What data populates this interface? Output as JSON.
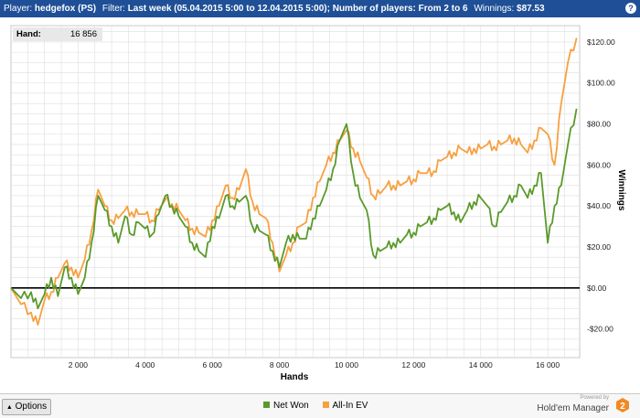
{
  "header": {
    "player_label": "Player:",
    "player_value": "hedgefox (PS)",
    "filter_label": "Filter:",
    "filter_value": "Last week (05.04.2015 5:00 to 12.04.2015 5:00); Number of players: From 2 to 6",
    "winnings_label": "Winnings:",
    "winnings_value": "$87.53",
    "help_icon": "help-icon"
  },
  "hand_box": {
    "label": "Hand:",
    "value": "16 856"
  },
  "bottom_bar": {
    "options_label": "Options",
    "options_icon": "caret-up-icon",
    "powered_by": "Powered by",
    "brand_name": "Hold'em Manager",
    "logo_icon": "hm2-logo-icon",
    "logo_text": "2"
  },
  "colors": {
    "title_bar": "#1f4f96",
    "net_won": "#5a9a2a",
    "all_in_ev": "#f7a040",
    "zero_line": "#000000",
    "grid": "#dedede",
    "logo": "#f08a24"
  },
  "chart_data": {
    "type": "line",
    "xlabel": "Hands",
    "ylabel": "Winnings",
    "xlim": [
      0,
      16950
    ],
    "ylim": [
      -34,
      128
    ],
    "x_ticks": [
      2000,
      4000,
      6000,
      8000,
      10000,
      12000,
      14000,
      16000
    ],
    "x_tick_labels": [
      "2 000",
      "4 000",
      "6 000",
      "8 000",
      "10 000",
      "12 000",
      "14 000",
      "16 000"
    ],
    "y_ticks": [
      -20,
      0,
      20,
      40,
      60,
      80,
      100,
      120
    ],
    "y_tick_labels": [
      "-$20.00",
      "$0.00",
      "$20.00",
      "$40.00",
      "$60.00",
      "$80.00",
      "$100.00",
      "$120.00"
    ],
    "grid": true,
    "legend_position": "bottom-center",
    "series": [
      {
        "name": "Net Won",
        "x": [
          0,
          300,
          600,
          800,
          1000,
          1200,
          1400,
          1600,
          1800,
          2000,
          2200,
          2400,
          2600,
          2800,
          3000,
          3200,
          3400,
          3600,
          3800,
          4000,
          4200,
          4400,
          4600,
          4800,
          5000,
          5200,
          5400,
          5600,
          5800,
          6000,
          6200,
          6400,
          6600,
          6800,
          7000,
          7200,
          7400,
          7600,
          7800,
          8000,
          8200,
          8400,
          8600,
          8800,
          9000,
          9200,
          9400,
          9600,
          9800,
          10000,
          10200,
          10400,
          10600,
          10800,
          11000,
          11200,
          11400,
          11600,
          11800,
          12000,
          12200,
          12400,
          12600,
          12800,
          13000,
          13200,
          13400,
          13600,
          13800,
          14000,
          14200,
          14400,
          14600,
          14800,
          15000,
          15200,
          15400,
          15600,
          15800,
          16000,
          16200,
          16400,
          16600,
          16856
        ],
        "y": [
          0,
          -5,
          -2,
          -10,
          -3,
          5,
          -4,
          10,
          5,
          -3,
          5,
          22,
          45,
          38,
          30,
          22,
          35,
          26,
          32,
          29,
          26,
          36,
          45,
          40,
          35,
          30,
          22,
          18,
          15,
          30,
          34,
          45,
          40,
          42,
          45,
          30,
          28,
          26,
          18,
          10,
          22,
          26,
          24,
          24,
          34,
          40,
          48,
          58,
          72,
          80,
          56,
          44,
          38,
          16,
          18,
          20,
          22,
          22,
          26,
          27,
          30,
          32,
          34,
          38,
          40,
          37,
          32,
          38,
          42,
          44,
          40,
          30,
          37,
          42,
          45,
          50,
          44,
          50,
          56,
          22,
          40,
          50,
          70,
          87.5
        ]
      },
      {
        "name": "All-In EV",
        "x": [
          0,
          300,
          600,
          800,
          1000,
          1200,
          1400,
          1600,
          1800,
          2000,
          2200,
          2400,
          2600,
          2800,
          3000,
          3200,
          3400,
          3600,
          3800,
          4000,
          4200,
          4400,
          4600,
          4800,
          5000,
          5200,
          5400,
          5600,
          5800,
          6000,
          6200,
          6400,
          6600,
          6800,
          7000,
          7200,
          7400,
          7600,
          7800,
          8000,
          8200,
          8400,
          8600,
          8800,
          9000,
          9200,
          9400,
          9600,
          9800,
          10000,
          10200,
          10400,
          10600,
          10800,
          11000,
          11200,
          11400,
          11600,
          11800,
          12000,
          12200,
          12400,
          12600,
          12800,
          13000,
          13200,
          13400,
          13600,
          13800,
          14000,
          14200,
          14400,
          14600,
          14800,
          15000,
          15200,
          15400,
          15600,
          15800,
          16000,
          16200,
          16400,
          16600,
          16856
        ],
        "y": [
          0,
          -8,
          -12,
          -18,
          -6,
          -2,
          5,
          12,
          10,
          5,
          14,
          28,
          48,
          40,
          33,
          34,
          38,
          37,
          36,
          36,
          33,
          38,
          43,
          41,
          38,
          33,
          29,
          27,
          25,
          33,
          40,
          50,
          44,
          48,
          58,
          42,
          36,
          34,
          22,
          8,
          16,
          22,
          30,
          32,
          44,
          52,
          60,
          66,
          72,
          77,
          68,
          62,
          54,
          45,
          46,
          50,
          50,
          50,
          52,
          53,
          56,
          56,
          57,
          62,
          64,
          66,
          68,
          66,
          68,
          68,
          70,
          69,
          70,
          72,
          73,
          70,
          66,
          72,
          78,
          75,
          60,
          90,
          110,
          122
        ]
      }
    ]
  }
}
